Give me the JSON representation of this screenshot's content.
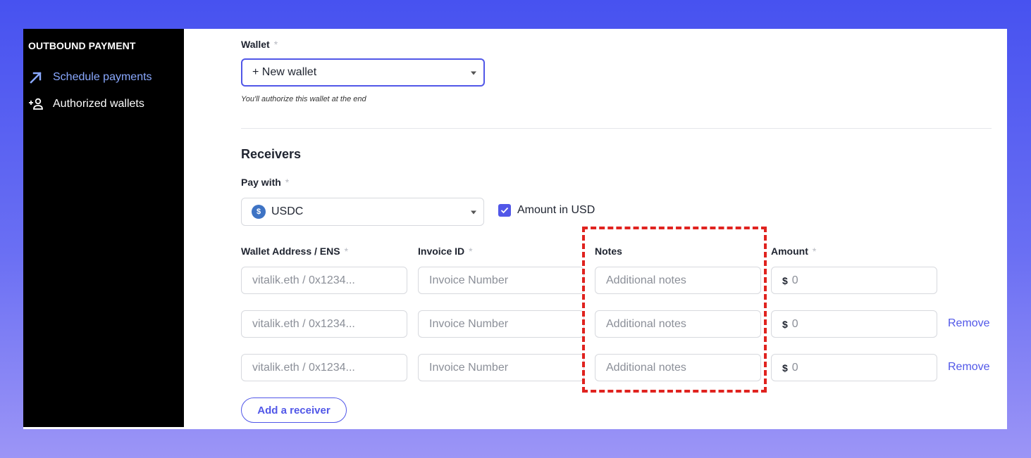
{
  "sidebar": {
    "heading": "OUTBOUND PAYMENT",
    "items": [
      {
        "label": "Schedule payments",
        "icon": "arrow-up-right-icon",
        "active": true
      },
      {
        "label": "Authorized wallets",
        "icon": "add-person-icon",
        "active": false
      }
    ]
  },
  "wallet": {
    "label": "Wallet",
    "required_mark": "*",
    "value": "+ New wallet",
    "helper": "You'll authorize this wallet at the end"
  },
  "receivers": {
    "title": "Receivers",
    "pay_with_label": "Pay with",
    "pay_with_value": "USDC",
    "amount_in_usd_label": "Amount in USD",
    "amount_in_usd_checked": true,
    "columns": {
      "wallet_address": "Wallet Address / ENS",
      "invoice_id": "Invoice ID",
      "notes": "Notes",
      "amount": "Amount"
    },
    "placeholders": {
      "wallet_address": "vitalik.eth / 0x1234...",
      "invoice_id": "Invoice Number",
      "notes": "Additional notes",
      "currency_symbol": "$",
      "amount": "0"
    },
    "remove_label": "Remove",
    "add_button": "Add a receiver"
  },
  "colors": {
    "accent": "#5157e8",
    "highlight": "#e0231f",
    "sidebar_bg": "#000000",
    "active_link": "#8aa9ff"
  }
}
